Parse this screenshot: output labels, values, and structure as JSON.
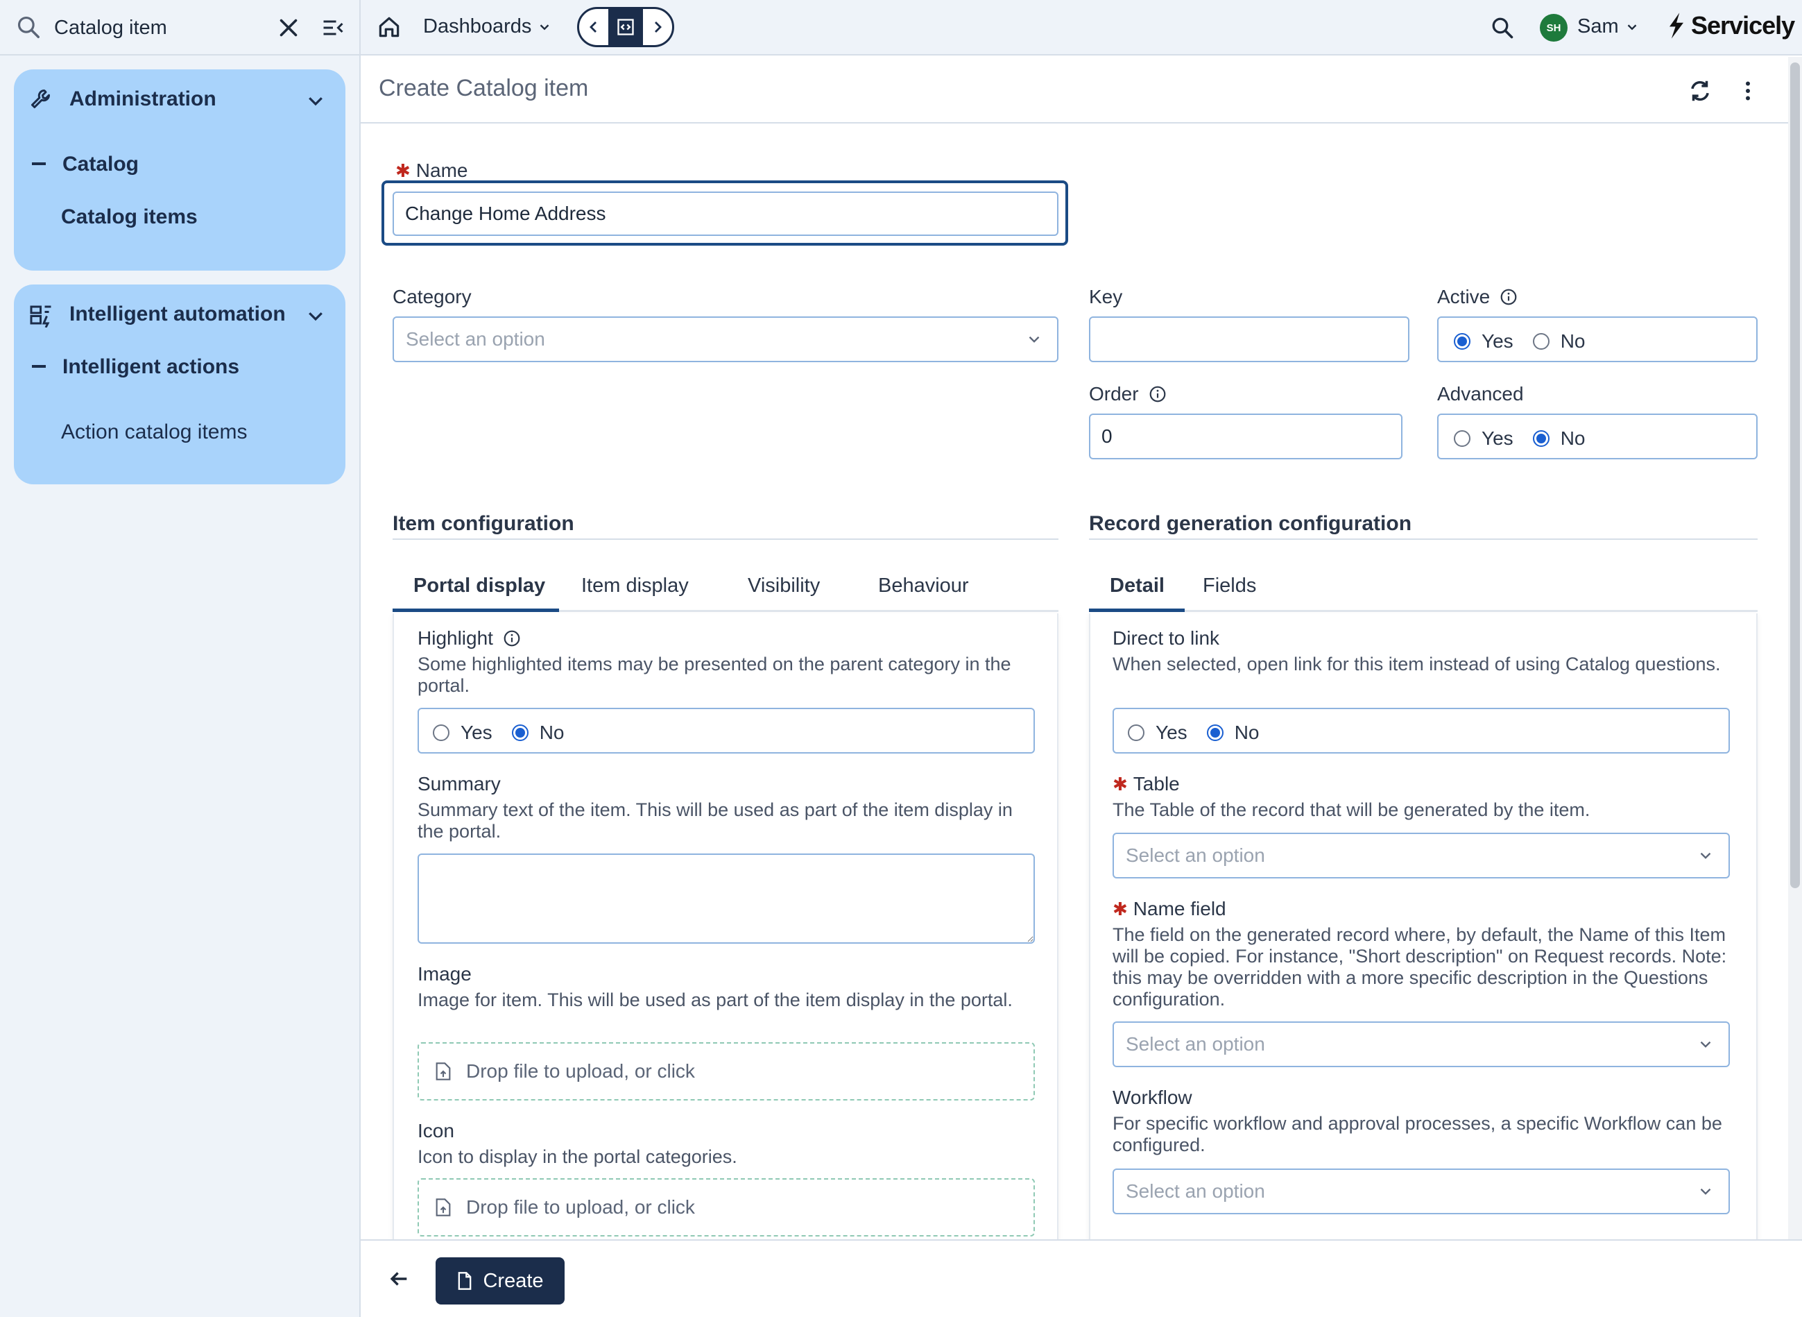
{
  "sidebar": {
    "search_value": "Catalog item",
    "groups": [
      {
        "label": "Administration",
        "sub": "Catalog",
        "leaf": "Catalog items"
      },
      {
        "label": "Intelligent automation",
        "sub": "Intelligent actions",
        "leaf": "Action catalog items"
      }
    ]
  },
  "topbar": {
    "dashboards_label": "Dashboards",
    "user_initials": "SH",
    "user_name": "Sam",
    "brand_name": "Servicely"
  },
  "page": {
    "title": "Create Catalog item"
  },
  "form": {
    "name": {
      "label": "Name",
      "value": "Change Home Address"
    },
    "category": {
      "label": "Category",
      "placeholder": "Select an option"
    },
    "key": {
      "label": "Key",
      "value": ""
    },
    "active": {
      "label": "Active",
      "yes": "Yes",
      "no": "No",
      "selected": "Yes"
    },
    "order": {
      "label": "Order",
      "value": "0"
    },
    "advanced": {
      "label": "Advanced",
      "yes": "Yes",
      "no": "No",
      "selected": "No"
    }
  },
  "item_config": {
    "title": "Item configuration",
    "tabs": [
      "Portal display",
      "Item display",
      "Visibility",
      "Behaviour"
    ],
    "active_tab": "Portal display",
    "highlight": {
      "label": "Highlight",
      "desc": "Some highlighted items may be presented on the parent category in the portal.",
      "yes": "Yes",
      "no": "No",
      "selected": "No"
    },
    "summary": {
      "label": "Summary",
      "desc": "Summary text of the item. This will be used as part of the item display in the portal."
    },
    "image": {
      "label": "Image",
      "desc": "Image for item. This will be used as part of the item display in the portal.",
      "drop_text": "Drop file to upload, or click"
    },
    "icon": {
      "label": "Icon",
      "desc": "Icon to display in the portal categories.",
      "drop_text": "Drop file to upload, or click"
    }
  },
  "record_config": {
    "title": "Record generation configuration",
    "tabs": [
      "Detail",
      "Fields"
    ],
    "active_tab": "Detail",
    "direct_link": {
      "label": "Direct to link",
      "desc": "When selected, open link for this item instead of using Catalog questions.",
      "yes": "Yes",
      "no": "No",
      "selected": "No"
    },
    "table": {
      "label": "Table",
      "desc": "The Table of the record that will be generated by the item.",
      "placeholder": "Select an option"
    },
    "name_field": {
      "label": "Name field",
      "desc": "The field on the generated record where, by default, the Name of this Item will be copied. For instance, \"Short description\" on Request records. Note: this may be overridden with a more specific description in the Questions configuration.",
      "placeholder": "Select an option"
    },
    "workflow": {
      "label": "Workflow",
      "desc": "For specific workflow and approval processes, a specific Workflow can be configured.",
      "placeholder": "Select an option"
    }
  },
  "footer": {
    "create_label": "Create"
  },
  "colors": {
    "sidebar_group": "#a9d3fb",
    "primary_dark": "#1b2d4b",
    "radio_selected": "#1a5fd1",
    "required_star": "#c0281e",
    "avatar_green": "#1e7a3c"
  }
}
